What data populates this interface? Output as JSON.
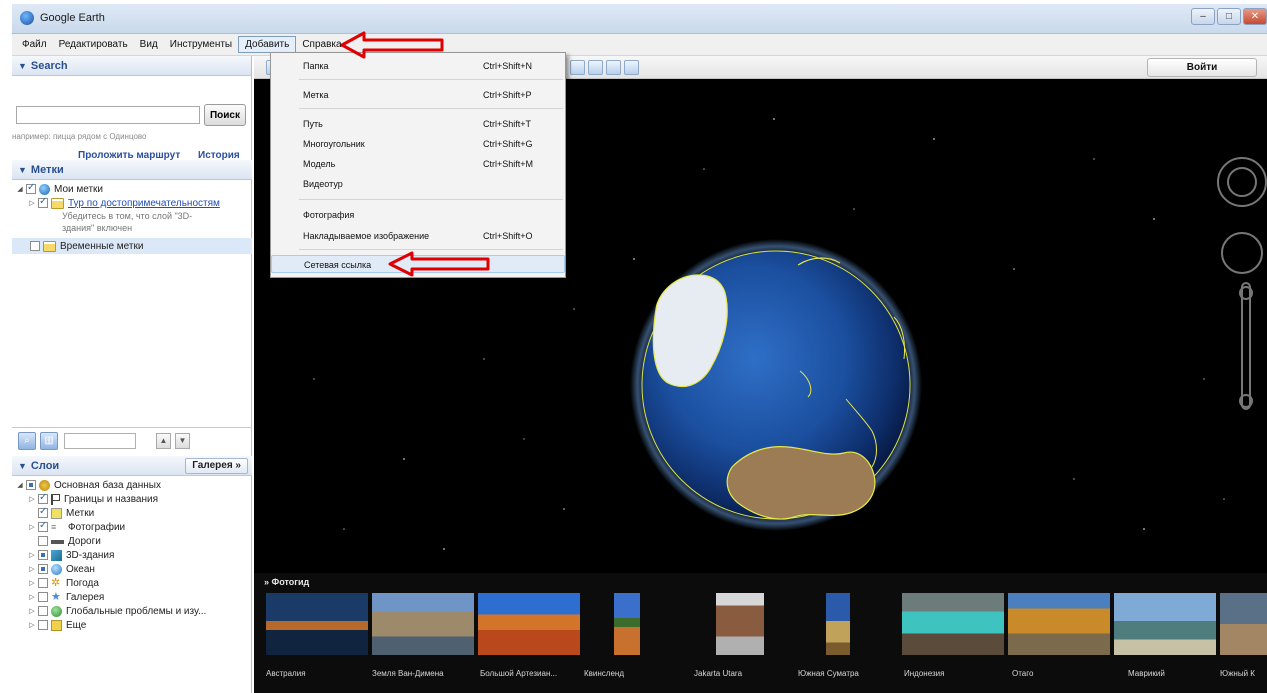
{
  "window": {
    "title": "Google Earth"
  },
  "menubar": {
    "items": [
      "Файл",
      "Редактировать",
      "Вид",
      "Инструменты",
      "Добавить",
      "Справка"
    ],
    "open_item": "Добавить"
  },
  "search": {
    "header": "Search",
    "button": "Поиск",
    "hint": "например: пицца рядом с Одинцово",
    "route_link": "Проложить маршрут",
    "history_link": "История"
  },
  "places": {
    "header": "Метки",
    "items": [
      {
        "label": "Мои метки"
      },
      {
        "label": "Тур по достопримечательностям"
      },
      {
        "label": "Временные метки"
      }
    ],
    "note_line1": "Убедитесь в том, что слой \"3D-",
    "note_line2": "здания\" включен"
  },
  "layers": {
    "header": "Слои",
    "gallery_button": "Галерея »",
    "items": [
      "Основная база данных",
      "Границы и названия",
      "Метки",
      "Фотографии",
      "Дороги",
      "3D-здания",
      "Океан",
      "Погода",
      "Галерея",
      "Глобальные проблемы и изу...",
      "Еще"
    ]
  },
  "toolbar": {
    "signin": "Войти"
  },
  "add_menu": {
    "items": [
      {
        "label": "Папка",
        "shortcut": "Ctrl+Shift+N"
      },
      {
        "label": "Метка",
        "shortcut": "Ctrl+Shift+P"
      },
      {
        "label": "Путь",
        "shortcut": "Ctrl+Shift+T"
      },
      {
        "label": "Многоугольник",
        "shortcut": "Ctrl+Shift+G"
      },
      {
        "label": "Модель",
        "shortcut": "Ctrl+Shift+M"
      },
      {
        "label": "Видеотур",
        "shortcut": ""
      },
      {
        "label": "Фотография",
        "shortcut": ""
      },
      {
        "label": "Накладываемое изображение",
        "shortcut": "Ctrl+Shift+O"
      },
      {
        "label": "Сетевая ссылка",
        "shortcut": ""
      }
    ],
    "highlighted": "Сетевая ссылка"
  },
  "photoguide": {
    "title": "Фотогид",
    "items": [
      "Австралия",
      "Земля Ван-Димена",
      "Большой Артезиан...",
      "Квинсленд",
      "Jakarta Utara",
      "Южная Суматра",
      "Индонезия",
      "Отаго",
      "Маврикий",
      "Южный К"
    ]
  },
  "colors": {
    "space": "#000000",
    "ocean": "#1f56a8",
    "border_highlight": "#ffff00",
    "annotation_arrow": "#e00000",
    "link": "#2a4f9c"
  }
}
